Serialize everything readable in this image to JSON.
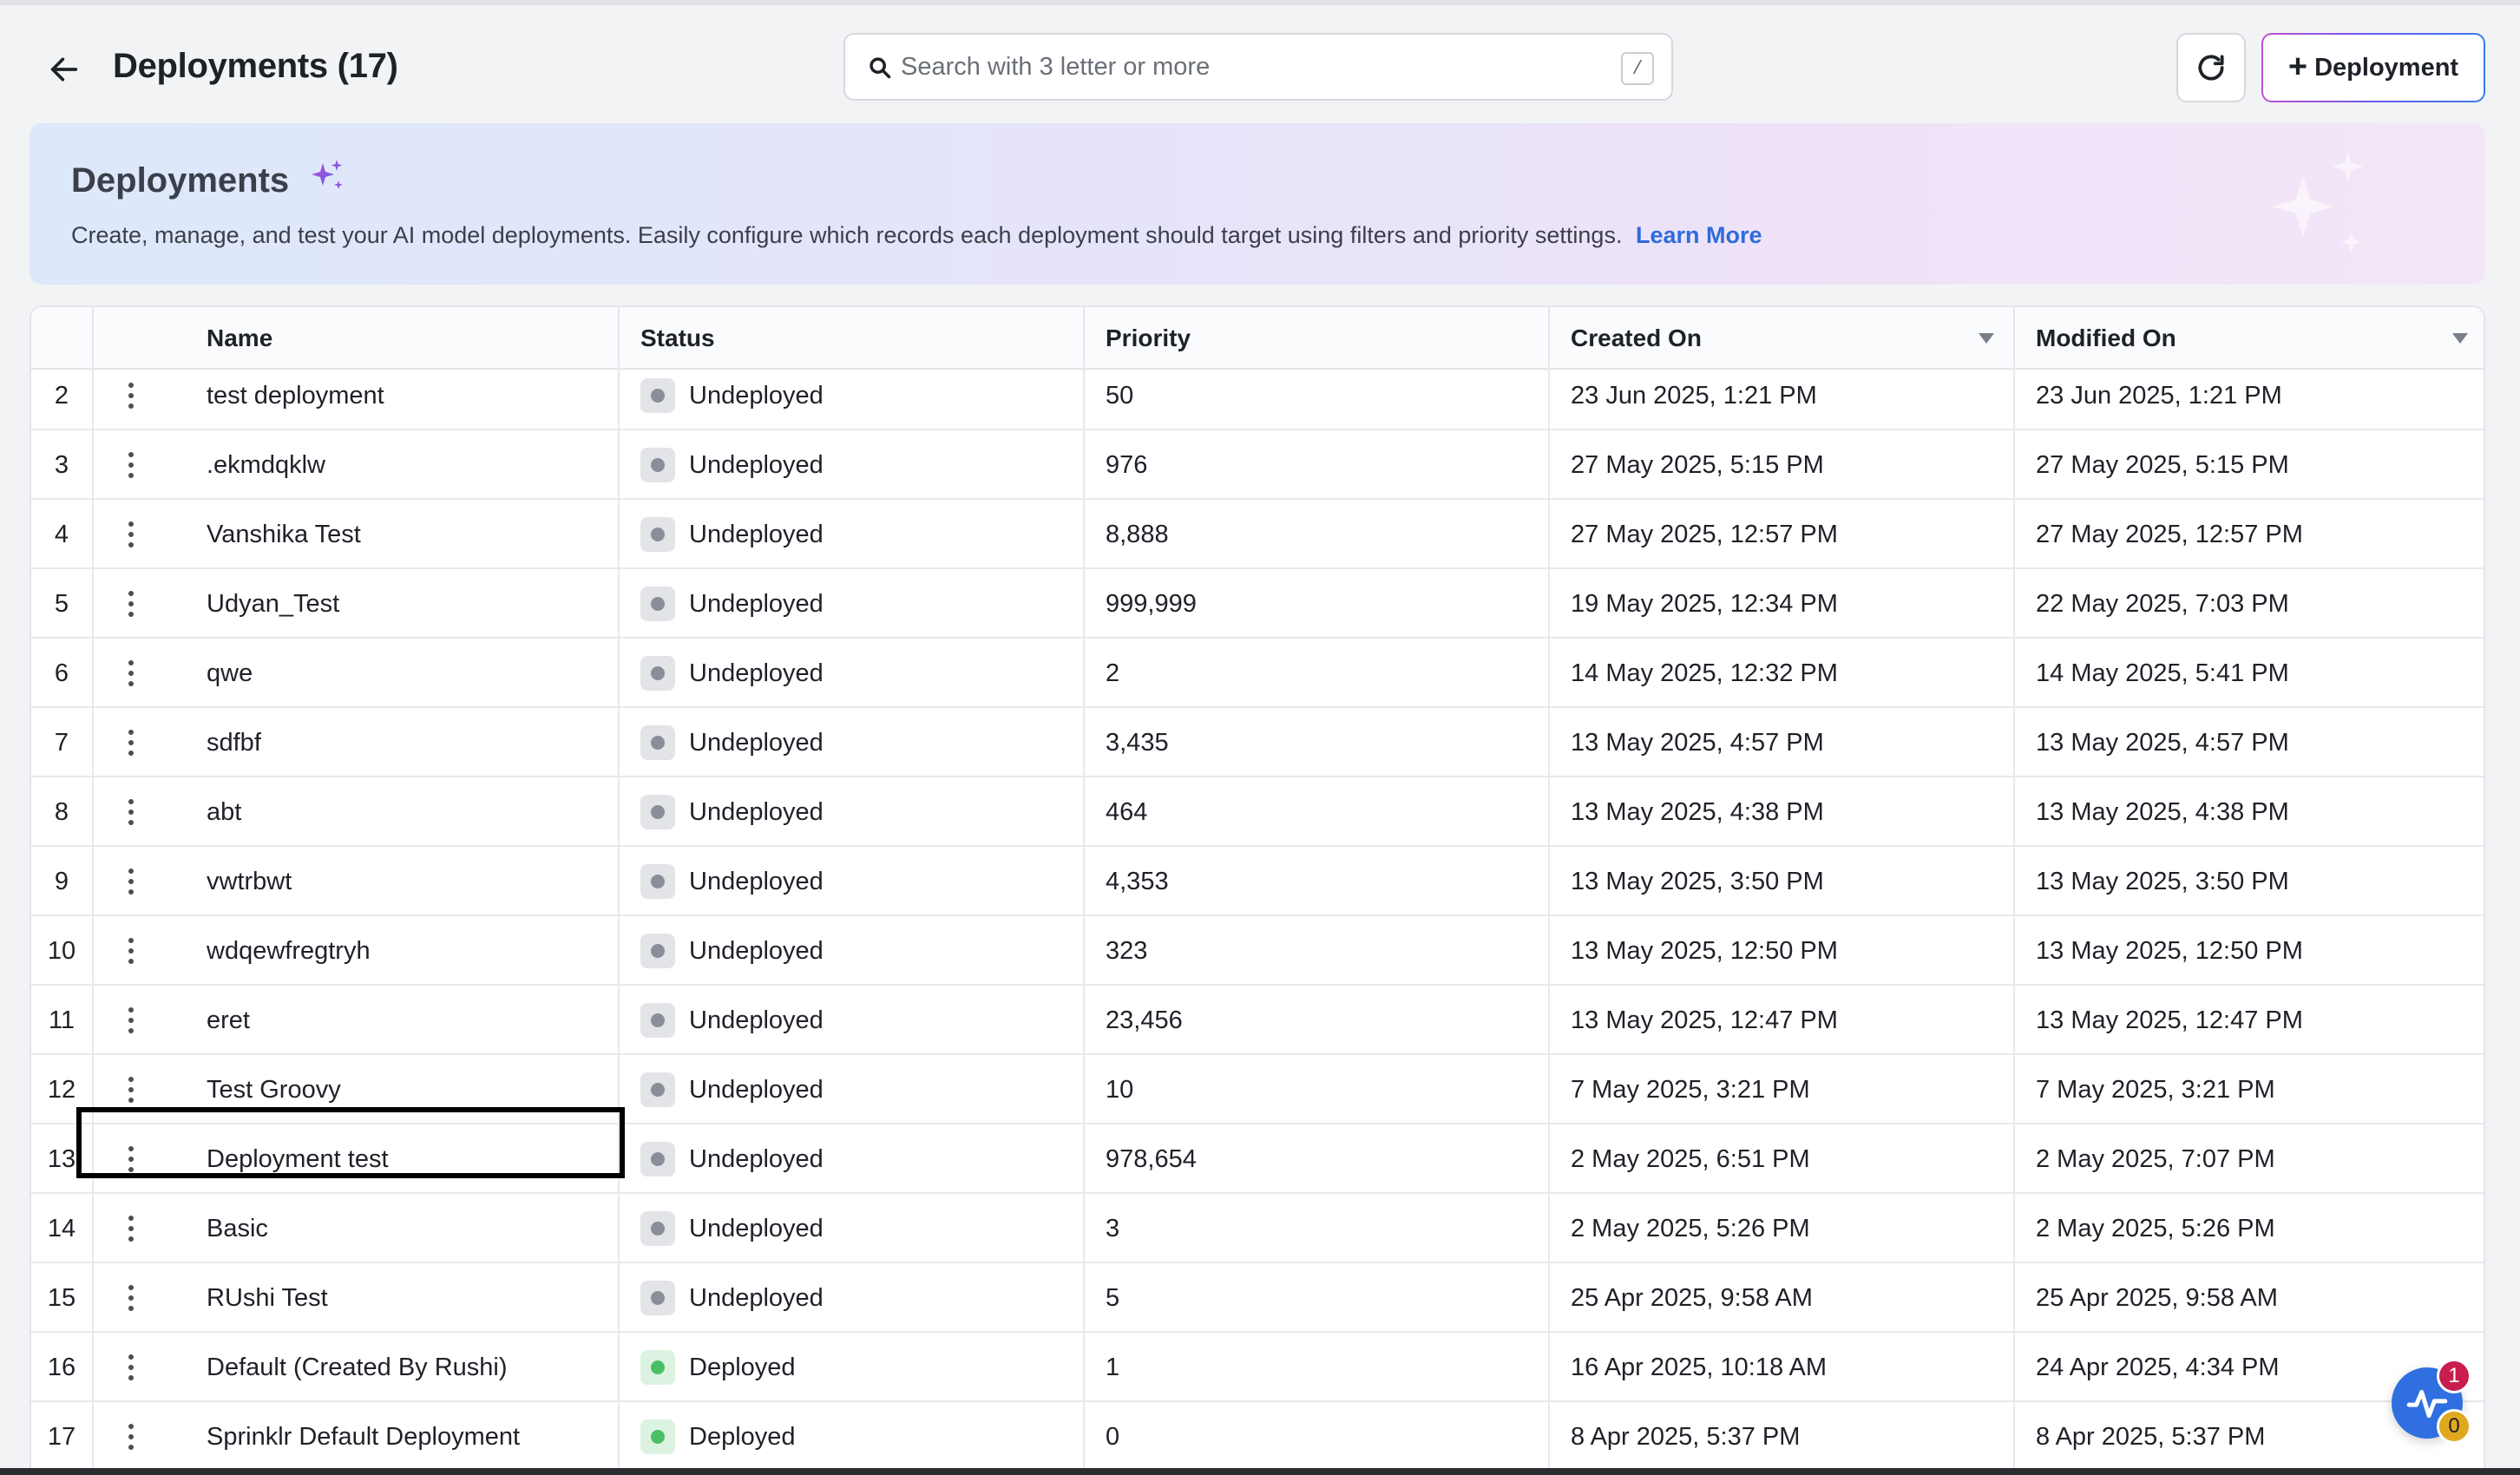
{
  "header": {
    "title": "Deployments (17)",
    "search_placeholder": "Search with 3 letter or more",
    "search_value": "",
    "search_shortcut": "/",
    "add_button_label": "Deployment"
  },
  "banner": {
    "title": "Deployments",
    "description": "Create, manage, and test your AI model deployments. Easily configure which records each deployment should target using filters and priority settings.",
    "link_label": "Learn More"
  },
  "table": {
    "columns": {
      "name": "Name",
      "status": "Status",
      "priority": "Priority",
      "created": "Created On",
      "modified": "Modified On"
    },
    "rows": [
      {
        "idx": "2",
        "name": "test deployment",
        "status": "Undeployed",
        "priority": "50",
        "created": "23 Jun 2025, 1:21 PM",
        "modified": "23 Jun 2025, 1:21 PM"
      },
      {
        "idx": "3",
        "name": ".ekmdqklw",
        "status": "Undeployed",
        "priority": "976",
        "created": "27 May 2025, 5:15 PM",
        "modified": "27 May 2025, 5:15 PM"
      },
      {
        "idx": "4",
        "name": "Vanshika Test",
        "status": "Undeployed",
        "priority": "8,888",
        "created": "27 May 2025, 12:57 PM",
        "modified": "27 May 2025, 12:57 PM"
      },
      {
        "idx": "5",
        "name": "Udyan_Test",
        "status": "Undeployed",
        "priority": "999,999",
        "created": "19 May 2025, 12:34 PM",
        "modified": "22 May 2025, 7:03 PM"
      },
      {
        "idx": "6",
        "name": "qwe",
        "status": "Undeployed",
        "priority": "2",
        "created": "14 May 2025, 12:32 PM",
        "modified": "14 May 2025, 5:41 PM"
      },
      {
        "idx": "7",
        "name": "sdfbf",
        "status": "Undeployed",
        "priority": "3,435",
        "created": "13 May 2025, 4:57 PM",
        "modified": "13 May 2025, 4:57 PM"
      },
      {
        "idx": "8",
        "name": "abt",
        "status": "Undeployed",
        "priority": "464",
        "created": "13 May 2025, 4:38 PM",
        "modified": "13 May 2025, 4:38 PM"
      },
      {
        "idx": "9",
        "name": "vwtrbwt",
        "status": "Undeployed",
        "priority": "4,353",
        "created": "13 May 2025, 3:50 PM",
        "modified": "13 May 2025, 3:50 PM"
      },
      {
        "idx": "10",
        "name": "wdqewfregtryh",
        "status": "Undeployed",
        "priority": "323",
        "created": "13 May 2025, 12:50 PM",
        "modified": "13 May 2025, 12:50 PM"
      },
      {
        "idx": "11",
        "name": "eret",
        "status": "Undeployed",
        "priority": "23,456",
        "created": "13 May 2025, 12:47 PM",
        "modified": "13 May 2025, 12:47 PM"
      },
      {
        "idx": "12",
        "name": "Test Groovy",
        "status": "Undeployed",
        "priority": "10",
        "created": "7 May 2025, 3:21 PM",
        "modified": "7 May 2025, 3:21 PM"
      },
      {
        "idx": "13",
        "name": "Deployment test",
        "status": "Undeployed",
        "priority": "978,654",
        "created": "2 May 2025, 6:51 PM",
        "modified": "2 May 2025, 7:07 PM"
      },
      {
        "idx": "14",
        "name": "Basic",
        "status": "Undeployed",
        "priority": "3",
        "created": "2 May 2025, 5:26 PM",
        "modified": "2 May 2025, 5:26 PM"
      },
      {
        "idx": "15",
        "name": "RUshi Test",
        "status": "Undeployed",
        "priority": "5",
        "created": "25 Apr 2025, 9:58 AM",
        "modified": "25 Apr 2025, 9:58 AM"
      },
      {
        "idx": "16",
        "name": "Default (Created By Rushi)",
        "status": "Deployed",
        "priority": "1",
        "created": "16 Apr 2025, 10:18 AM",
        "modified": "24 Apr 2025, 4:34 PM"
      },
      {
        "idx": "17",
        "name": "Sprinklr Default Deployment",
        "status": "Deployed",
        "priority": "0",
        "created": "8 Apr 2025, 5:37 PM",
        "modified": "8 Apr 2025, 5:37 PM"
      }
    ]
  },
  "widget": {
    "badge_top": "1",
    "badge_bottom": "0"
  },
  "colors": {
    "accent": "#2e6bdc",
    "deployed": "#4bbf66",
    "undeployed": "#8a8e99",
    "badge_red": "#c81d4e",
    "badge_yellow": "#e0a81e"
  },
  "icons": {
    "back": "arrow-left-icon",
    "search": "search-icon",
    "refresh": "refresh-icon",
    "add": "plus-icon",
    "sparkle": "sparkle-icon",
    "row_menu": "kebab-menu-icon",
    "sort": "caret-down-icon",
    "widget": "activity-pulse-icon"
  }
}
